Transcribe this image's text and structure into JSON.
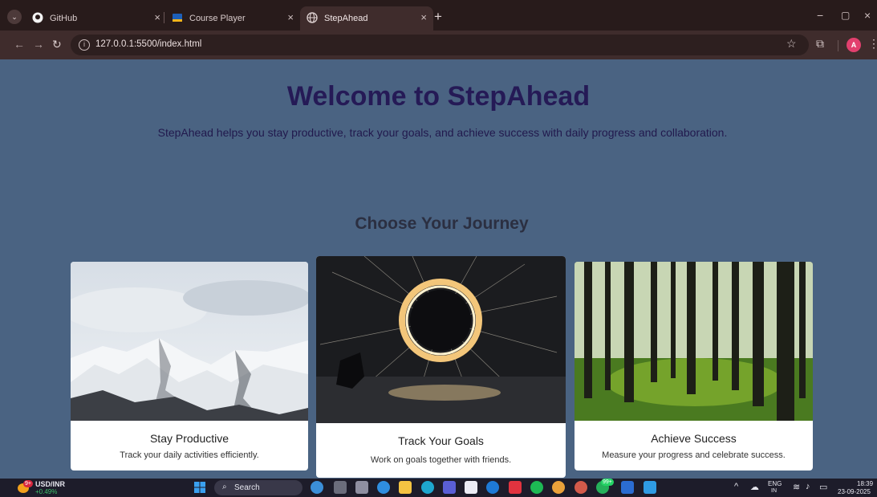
{
  "browser": {
    "tabs": [
      {
        "label": "GitHub",
        "close": "×"
      },
      {
        "label": "Course Player",
        "close": "×"
      },
      {
        "label": "StepAhead",
        "close": "×"
      }
    ],
    "new_tab": "+",
    "window_controls": {
      "minimize": "−",
      "restore": "▢",
      "close": "×"
    },
    "url": "127.0.0.1:5500/index.html",
    "profile_initial": "A",
    "icons": [
      "back-arrow-icon",
      "forward-arrow-icon",
      "reload-icon",
      "info-icon",
      "star-icon",
      "extensions-icon",
      "kebab-menu-icon"
    ]
  },
  "page": {
    "title": "Welcome to StepAhead",
    "subtitle": "StepAhead helps you stay productive, track your goals, and achieve success with daily progress and collaboration.",
    "section_title": "Choose Your Journey",
    "cards": [
      {
        "title": "Stay Productive",
        "description": "Track your daily activities efficiently."
      },
      {
        "title": "Track Your Goals",
        "description": "Work on goals together with friends."
      },
      {
        "title": "Achieve Success",
        "description": "Measure your progress and celebrate success."
      }
    ]
  },
  "taskbar": {
    "widget_badge": "9+",
    "widget_title": "USD/INR",
    "widget_value": "+0.49%",
    "search_label": "Search",
    "chat_badge": "99+",
    "language": "ENG",
    "region": "IN",
    "time": "18:39",
    "date": "23-09-2025"
  }
}
